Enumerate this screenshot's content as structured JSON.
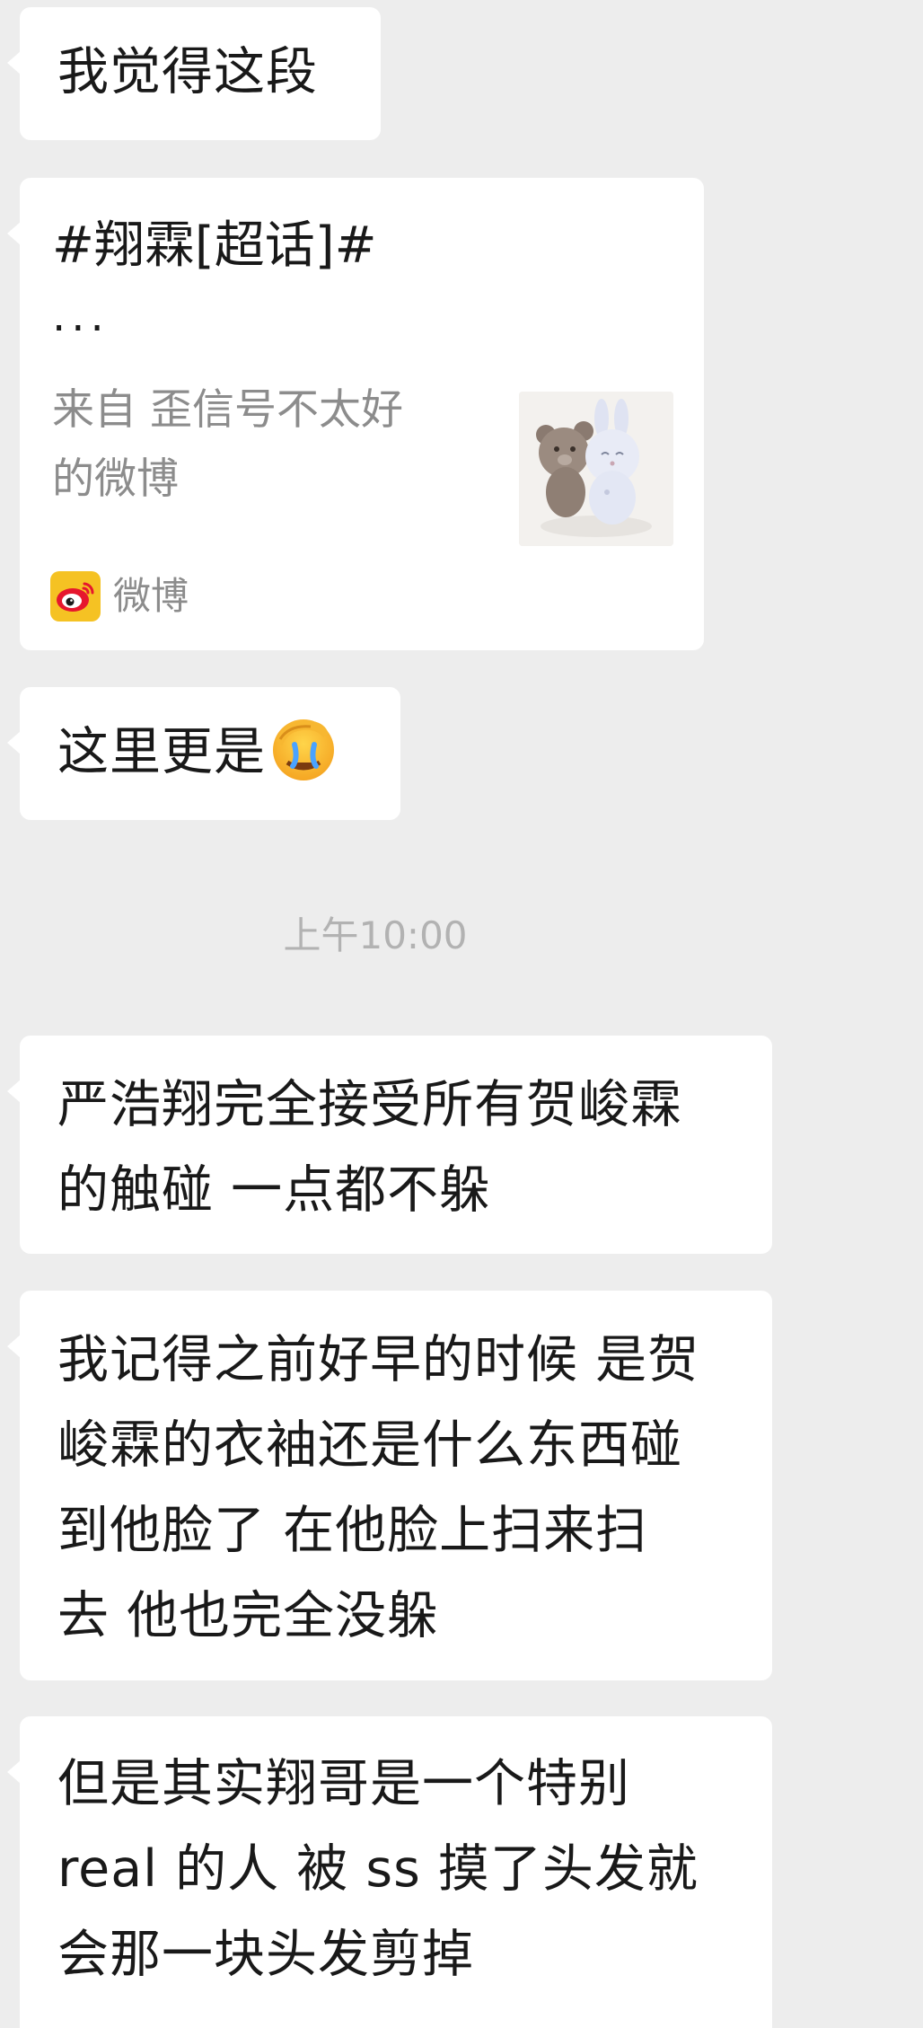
{
  "messages": {
    "m1": "我觉得这段",
    "m3": "这里更是",
    "m4": [
      "严浩翔完全接受所有贺峻霖",
      "的触碰 一点都不躲"
    ],
    "m5": [
      "我记得之前好早的时候 是贺",
      "峻霖的衣袖还是什么东西碰",
      "到他脸了 在他脸上扫来扫",
      "去 他也完全没躲"
    ],
    "m6": [
      "但是其实翔哥是一个特别",
      "real 的人 被 ss 摸了头发就",
      "会那一块头发剪掉"
    ]
  },
  "weibo_card": {
    "title": "#翔霖[超话]#",
    "ellipsis": "...",
    "source_line1": "来自 歪信号不太好",
    "source_line2": "的微博",
    "app_label": "微博",
    "thumbnail_icon": "bear-and-bunny-plush-thumbnail"
  },
  "timestamp": "上午10:00",
  "emoji_icon": "face-palm-crying-emoji",
  "colors": {
    "background": "#ededed",
    "bubble": "#ffffff",
    "weibo_yellow": "#f5c223",
    "weibo_red": "#e6162d",
    "secondary_text": "#8c8c8c",
    "timestamp_text": "#b2b2b2"
  }
}
